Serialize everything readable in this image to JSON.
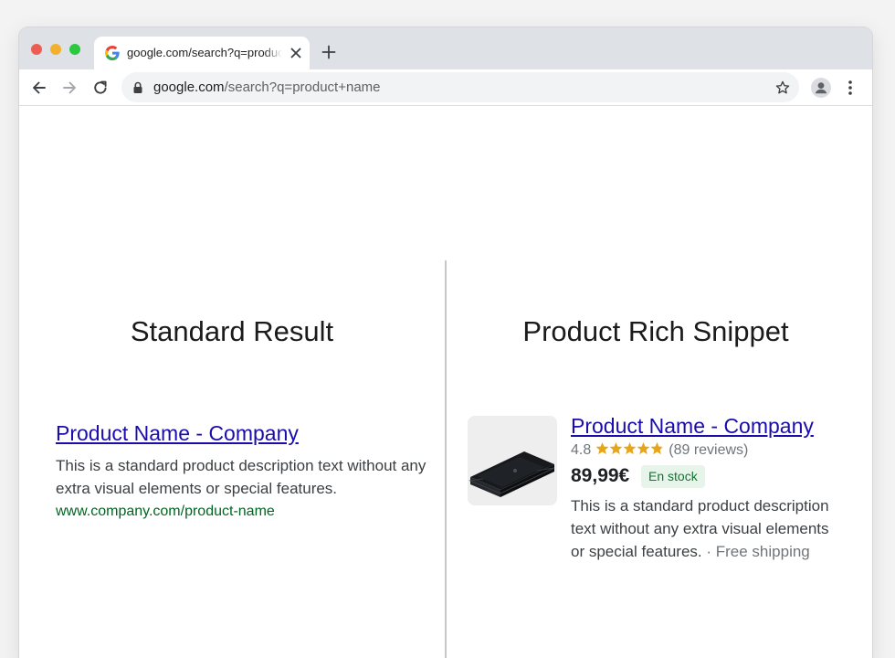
{
  "browser": {
    "tab": {
      "title": "google.com/search?q=product+name",
      "favicon": "google-g-icon"
    },
    "address_bar": {
      "host": "google.com",
      "path": "/search?q=product+name"
    },
    "icons": {
      "back": "arrow-left-icon",
      "forward": "arrow-right-icon",
      "reload": "reload-icon",
      "lock": "lock-icon",
      "bookmark": "star-outline-icon",
      "profile": "person-icon",
      "menu": "kebab-menu-icon",
      "new_tab": "plus-icon",
      "close_tab": "close-icon"
    }
  },
  "standard": {
    "heading": "Standard Result",
    "title": "Product Name - Company",
    "description": "This is a standard product description text without any extra visual elements or special features.",
    "url": "www.company.com/product-name"
  },
  "rich": {
    "heading": "Product Rich Snippet",
    "title": "Product Name - Company",
    "rating_value": "4.8",
    "rating_stars": 4.8,
    "rating_max": 5,
    "reviews": "(89 reviews)",
    "price": "89,99€",
    "stock": "En stock",
    "description": "This is a standard product description text without any extra visual elements or special features.",
    "separator": " · ",
    "shipping": "Free shipping",
    "image": "game-console-image"
  },
  "colors": {
    "link": "#1a0dab",
    "url_green": "#006621",
    "star": "#e7a519",
    "stock_badge_bg": "#e6f4ea",
    "stock_badge_text": "#137333"
  }
}
